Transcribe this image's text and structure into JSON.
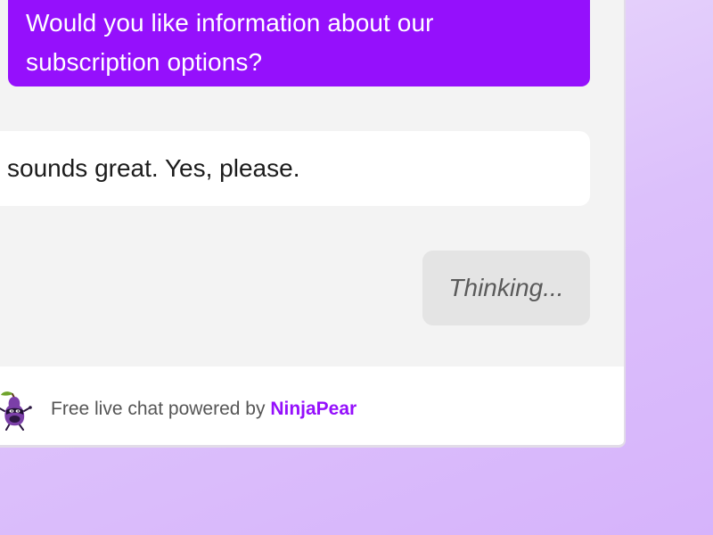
{
  "messages": [
    {
      "role": "agent",
      "lines": [
        "Would you like information about our",
        "subscription options?"
      ]
    },
    {
      "role": "user",
      "text": "sounds great. Yes, please."
    },
    {
      "role": "agent-status",
      "text": "Thinking..."
    }
  ],
  "footer": {
    "text": "Free live chat powered by",
    "brand": "NinjaPear",
    "logo_icon": "ninjapear-mascot-icon"
  },
  "colors": {
    "accent": "#9510fc",
    "agent_bubble": "#9510fc",
    "user_bubble": "#ffffff",
    "thinking_bubble": "#e4e4e4",
    "panel_bg": "#f3f3f3",
    "page_bg_top": "#ede0fb",
    "page_bg_bottom": "#d6b3fb"
  }
}
